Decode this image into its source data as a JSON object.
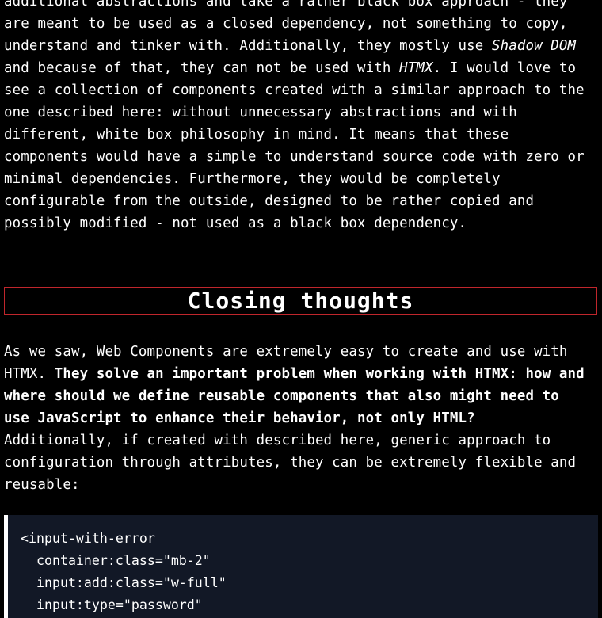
{
  "paragraph_1": {
    "lines": [
      {
        "parts": [
          "additional abstractions and take a rather black box approach - they"
        ]
      },
      {
        "parts": [
          "are meant to be used as a closed dependency, not something to copy,"
        ]
      },
      {
        "parts": [
          "understand and tinker with. Additionally, they mostly use ",
          "Shadow DOM"
        ]
      },
      {
        "parts": [
          "and because of that, they can not be used with ",
          "HTMX",
          ". I would love to"
        ]
      },
      {
        "parts": [
          "see a collection of components created with a similar approach to the"
        ]
      },
      {
        "parts": [
          "one described here: without unnecessary abstractions and with"
        ]
      },
      {
        "parts": [
          "different, white box philosophy in mind. It means that these"
        ]
      },
      {
        "parts": [
          "components would have a simple to understand source code with zero or"
        ]
      },
      {
        "parts": [
          "minimal dependencies. Furthermore, they would be completely"
        ]
      },
      {
        "parts": [
          "configurable from the outside, designed to be rather copied and"
        ]
      },
      {
        "parts": [
          "possibly modified - not used as a black box dependency."
        ]
      }
    ]
  },
  "section_heading": "Closing thoughts",
  "paragraph_2": {
    "lines": [
      {
        "parts": [
          "As we saw, Web Components are extremely easy to create and use with"
        ]
      },
      {
        "parts": [
          "HTMX. ",
          "They solve an important problem when working with HTMX: how and"
        ]
      },
      {
        "parts": [
          "where should we define reusable components that also might need to"
        ]
      },
      {
        "parts": [
          "use JavaScript to enhance their behavior, not only HTML?"
        ]
      },
      {
        "parts": [
          "Additionally, if created with described here, generic approach to"
        ]
      },
      {
        "parts": [
          "configuration through attributes, they can be extremely flexible and"
        ]
      },
      {
        "parts": [
          "reusable:"
        ]
      }
    ]
  },
  "code_block": {
    "lines": [
      "<input-with-error",
      "  container:class=\"mb-2\"",
      "  input:add:class=\"w-full\"",
      "  input:type=\"password\""
    ]
  },
  "colors": {
    "background": "#000000",
    "text": "#ffffff",
    "heading_border": "#c0262c",
    "code_background": "#121826"
  }
}
